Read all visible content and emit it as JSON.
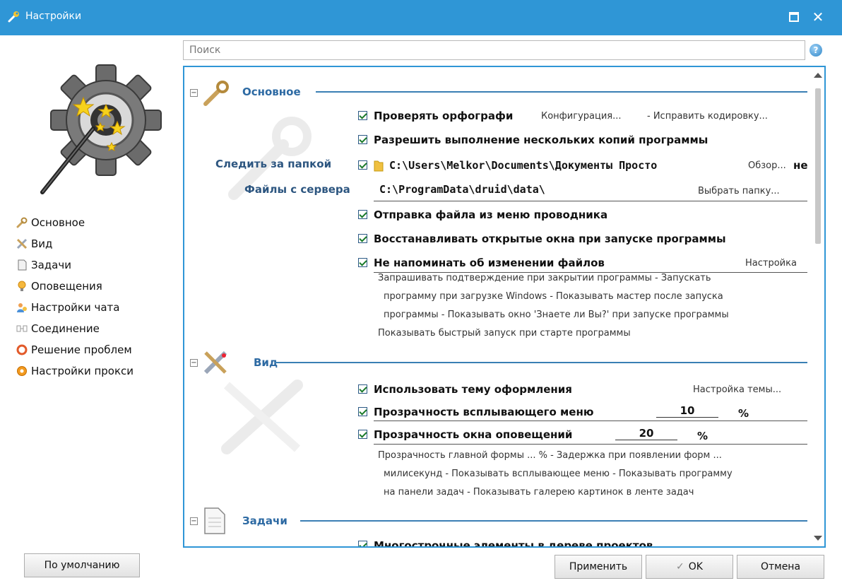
{
  "window": {
    "title": "Настройки",
    "maximize_icon": "maximize-icon",
    "close_icon": "close-icon"
  },
  "search": {
    "placeholder": "Поиск"
  },
  "sidebar": {
    "items": [
      {
        "label": "Основное",
        "icon": "wrench-icon"
      },
      {
        "label": "Вид",
        "icon": "pencil-ruler-icon"
      },
      {
        "label": "Задачи",
        "icon": "document-icon"
      },
      {
        "label": "Оповещения",
        "icon": "bulb-icon"
      },
      {
        "label": "Настройки чата",
        "icon": "chat-users-icon"
      },
      {
        "label": "Соединение",
        "icon": "connection-icon"
      },
      {
        "label": "Решение проблем",
        "icon": "lifebuoy-icon"
      },
      {
        "label": "Настройки прокси",
        "icon": "proxy-icon"
      }
    ]
  },
  "sections": {
    "basic": {
      "title": "Основное",
      "spellcheck": {
        "label": "Проверять орфографи",
        "link1": "Конфигурация...",
        "link2": "- Исправить кодировку..."
      },
      "multi_instance": {
        "label": "Разрешить выполнение нескольких копий программы"
      },
      "watch_folder": {
        "caption": "Следить за папкой",
        "path": "C:\\Users\\Melkor\\Documents\\Документы Просто",
        "browse": "Обзор...",
        "tail": "не"
      },
      "server_files": {
        "caption": "Файлы с сервера",
        "path": "C:\\ProgramData\\druid\\data\\",
        "choose": "Выбрать папку..."
      },
      "send_file": {
        "label": "Отправка файла из меню проводника"
      },
      "restore_windows": {
        "label": "Восстанавливать открытые окна при запуске программы"
      },
      "no_remind": {
        "label": "Не напоминать об изменении файлов",
        "link": "Настройка"
      },
      "more": [
        "Запрашивать подтверждение при закрытии программы - Запускать",
        "программу при загрузке Windows - Показывать мастер после запуска",
        "программы - Показывать окно 'Знаете ли Вы?' при запуске программы",
        "Показывать быстрый запуск при старте программы"
      ]
    },
    "view": {
      "title": "Вид",
      "theme": {
        "label": "Использовать тему оформления",
        "link": "Настройка темы..."
      },
      "menu_transparency": {
        "label": "Прозрачность всплывающего меню",
        "value": "10",
        "unit": "%"
      },
      "notify_transparency": {
        "label": "Прозрачность окна оповещений",
        "value": "20",
        "unit": "%"
      },
      "more": [
        "Прозрачность главной формы ... % - Задержка при появлении форм ...",
        "милисекунд - Показывать всплывающее меню - Показывать программу",
        "на панели задач - Показывать галерею картинок в ленте задач"
      ]
    },
    "tasks": {
      "title": "Задачи",
      "partial_label": "Многострочные элементы в дереве проектов"
    }
  },
  "buttons": {
    "defaults": "По умолчанию",
    "apply": "Применить",
    "ok": "OK",
    "cancel": "Отмена"
  },
  "colors": {
    "titlebar": "#2f96d6",
    "section_title": "#2d6aa3",
    "accent_line": "#3a7fb4"
  }
}
